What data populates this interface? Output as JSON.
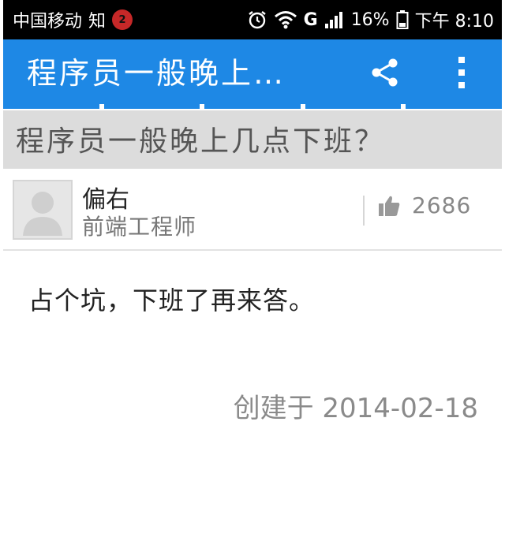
{
  "status_bar": {
    "carrier": "中国移动",
    "app_label": "知",
    "notification_count": "2",
    "signal_type": "G",
    "battery": "16%",
    "time": "下午 8:10"
  },
  "app_bar": {
    "title": "程序员一般晚上…"
  },
  "question": {
    "title": "程序员一般晚上几点下班？"
  },
  "author": {
    "name": "偏右",
    "title": "前端工程师",
    "likes": "2686"
  },
  "answer": {
    "content": "占个坑，下班了再来答。",
    "created": "创建于 2014-02-18"
  },
  "colors": {
    "app_bar": "#1e88e5",
    "question_bg": "#dcdcdc",
    "status_bar": "#000000"
  },
  "icons": [
    "alarm-icon",
    "wifi-icon",
    "signal-icon",
    "battery-icon",
    "share-icon",
    "more-vert-icon",
    "avatar-placeholder-icon",
    "thumbs-up-icon"
  ]
}
